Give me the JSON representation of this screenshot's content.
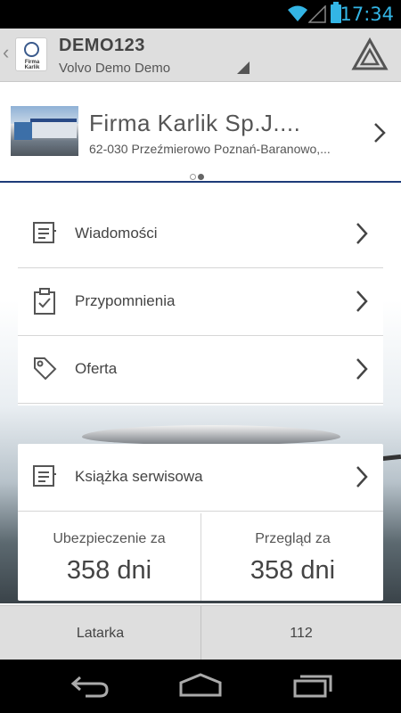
{
  "status_bar": {
    "time": "17:34",
    "icons": [
      "wifi-icon",
      "signal-icon",
      "battery-icon"
    ],
    "accent_color": "#33b5e5"
  },
  "action_bar": {
    "title": "DEMO123",
    "subtitle": "Volvo Demo Demo",
    "logo_text": "Firma Karlik",
    "icons": [
      "back-chevron-icon",
      "dealer-logo",
      "spinner-triangle-icon",
      "warning-triangle-icon"
    ]
  },
  "dealer": {
    "name": "Firma Karlik Sp.J....",
    "address": "62-030 Przeźmierowo Poznań-Baranowo,...",
    "page_indicator": {
      "count": 2,
      "active": 2
    },
    "accent_color": "#1d3b78"
  },
  "menu": {
    "items": [
      {
        "label": "Wiadomości",
        "icon": "messages-icon"
      },
      {
        "label": "Przypomnienia",
        "icon": "reminder-clipboard-icon"
      },
      {
        "label": "Oferta",
        "icon": "tag-icon"
      }
    ],
    "service_book": {
      "label": "Książka serwisowa",
      "icon": "service-book-icon"
    }
  },
  "stats": {
    "insurance": {
      "caption": "Ubezpieczenie za",
      "value": "358 dni"
    },
    "inspection": {
      "caption": "Przegląd za",
      "value": "358 dni"
    }
  },
  "bottom_bar": {
    "left_label": "Latarka",
    "right_label": "112"
  },
  "nav_bar": {
    "icons": [
      "back-icon",
      "home-icon",
      "recents-icon"
    ]
  }
}
